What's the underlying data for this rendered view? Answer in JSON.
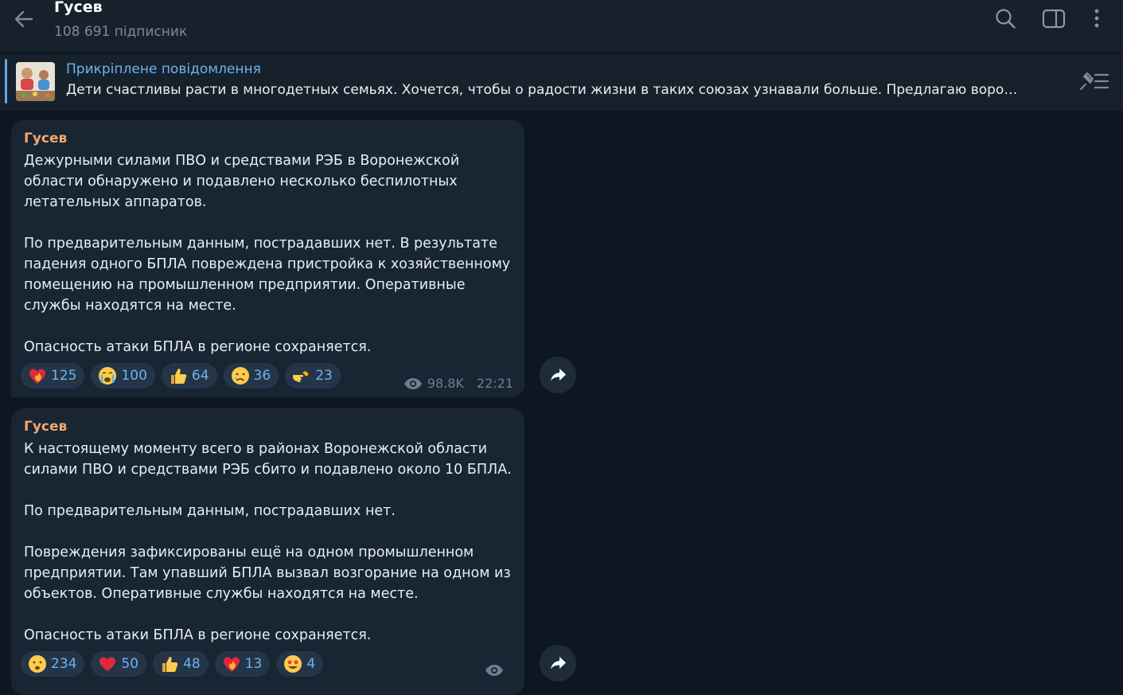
{
  "header": {
    "title": "Гусев",
    "subtitle": "108 691 підписник"
  },
  "pinned": {
    "title": "Прикріплене повідомлення",
    "text": "Дети счастливы расти в многодетных семьях. Хочется, чтобы о радости жизни в таких союзах узнавали больше.   Предлагаю воро…"
  },
  "colors": {
    "background": "#0e1621",
    "panel": "#17212b",
    "bubble": "#182533",
    "accent": "#6ab3f3",
    "author": "#f5a76b"
  },
  "icons": [
    "back-arrow-icon",
    "search-icon",
    "sidebar-toggle-icon",
    "more-vertical-icon",
    "unpin-list-icon",
    "eye-icon",
    "share-arrow-icon"
  ],
  "messages": [
    {
      "author": "Гусев",
      "text": "Дежурными силами ПВО и средствами РЭБ в Воронежской области обнаружено и подавлено несколько беспилотных летательных аппаратов.\n\nПо предварительным данным, пострадавших нет. В результате падения одного БПЛА повреждена пристройка к хозяйственному помещению на промышленном предприятии. Оперативные службы находятся на месте.\n\nОпасность атаки БПЛА в регионе сохраняется.",
      "reactions": [
        {
          "emoji": "heart-on-fire",
          "count": "125"
        },
        {
          "emoji": "crying-face",
          "count": "100"
        },
        {
          "emoji": "thumbs-up",
          "count": "64"
        },
        {
          "emoji": "sad-face",
          "count": "36"
        },
        {
          "emoji": "pointing-hand",
          "count": "23"
        }
      ],
      "views": "98.8K",
      "time": "22:21"
    },
    {
      "author": "Гусев",
      "text": "К настоящему моменту всего в районах Воронежской области силами ПВО и средствами РЭБ сбито и подавлено около 10 БПЛА.\n\nПо предварительным данным, пострадавших нет.\n\nПовреждения зафиксированы ещё на одном промышленном предприятии. Там упавший БПЛА вызвал возгорание на одном из объектов. Оперативные службы находятся на месте.\n\nОпасность атаки БПЛА в регионе сохраняется.",
      "reactions": [
        {
          "emoji": "worried-face",
          "count": "234"
        },
        {
          "emoji": "red-heart",
          "count": "50"
        },
        {
          "emoji": "thumbs-up",
          "count": "48"
        },
        {
          "emoji": "heart-on-fire",
          "count": "13"
        },
        {
          "emoji": "star-struck",
          "count": "4"
        }
      ],
      "views": "",
      "time": ""
    }
  ]
}
